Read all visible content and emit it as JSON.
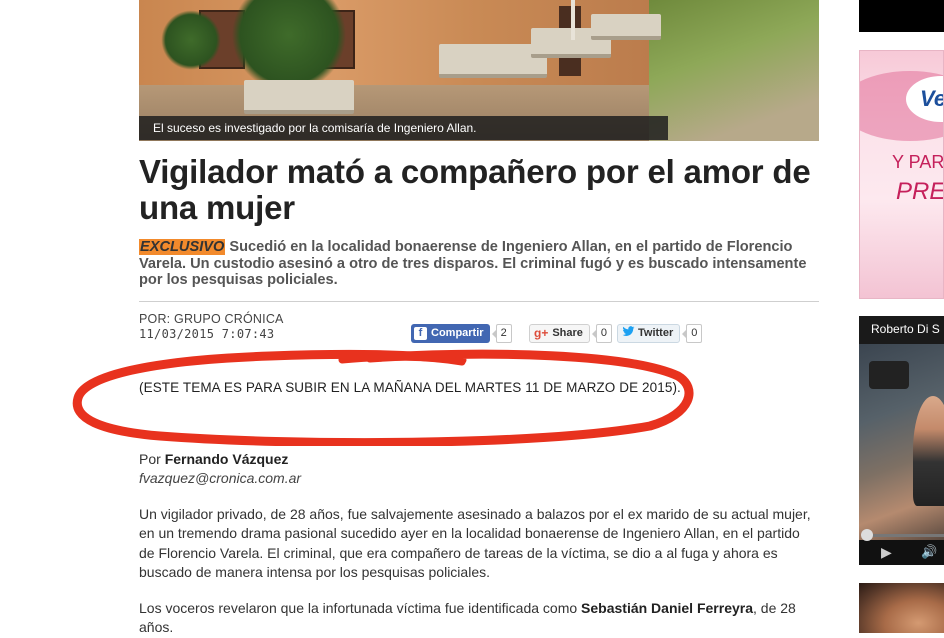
{
  "hero": {
    "caption": "El suceso es investigado por la comisaría de Ingeniero Allan."
  },
  "article": {
    "headline": "Vigilador mató a compañero por el amor de una mujer",
    "lead_tag": "EXCLUSIVO",
    "lead_text": " Sucedió en la localidad bonaerense de Ingeniero Allan, en el partido de Florencio Varela. Un custodio asesinó a otro de tres disparos. El criminal fugó y es buscado intensamente por los pesquisas policiales.",
    "byline": "POR: GRUPO CRÓNICA",
    "date": "11/03/2015 7:07:43",
    "note": "(ESTE TEMA ES PARA SUBIR EN LA MAÑANA DEL MARTES 11 DE MARZO DE 2015).",
    "author_prefix": "Por ",
    "author_name": "Fernando Vázquez",
    "author_email": "fvazquez@cronica.com.ar",
    "paragraph1": "Un vigilador privado, de 28 años, fue salvajemente asesinado a balazos por el ex marido de su actual mujer, en un tremendo drama pasional sucedido ayer en la localidad bonaerense de Ingeniero Allan, en el partido de Florencio Varela. El criminal, que era compañero de tareas de la víctima, se dio a al fuga y ahora es buscado de manera intensa por los pesquisas policiales.",
    "paragraph2_pre": "Los voceros revelaron que la infortunada víctima fue identificada como ",
    "paragraph2_bold": "Sebastián Daniel Ferreyra",
    "paragraph2_post": ", de 28 años."
  },
  "share": {
    "facebook_label": "Compartir",
    "facebook_icon": "f",
    "facebook_count": "2",
    "gplus_icon": "g+",
    "gplus_label": "Share",
    "gplus_count": "0",
    "twitter_label": "Twitter",
    "twitter_count": "0"
  },
  "sidebar": {
    "veet_logo": "Ve",
    "veet_line1": "Y PAR",
    "veet_line2": "PRE",
    "video_title": "Roberto Di S",
    "play_icon": "▶",
    "volume_icon": "🔊"
  },
  "colors": {
    "tag_bg": "#f28a2c",
    "facebook": "#4267b2",
    "annotation_red": "#e8321e"
  }
}
